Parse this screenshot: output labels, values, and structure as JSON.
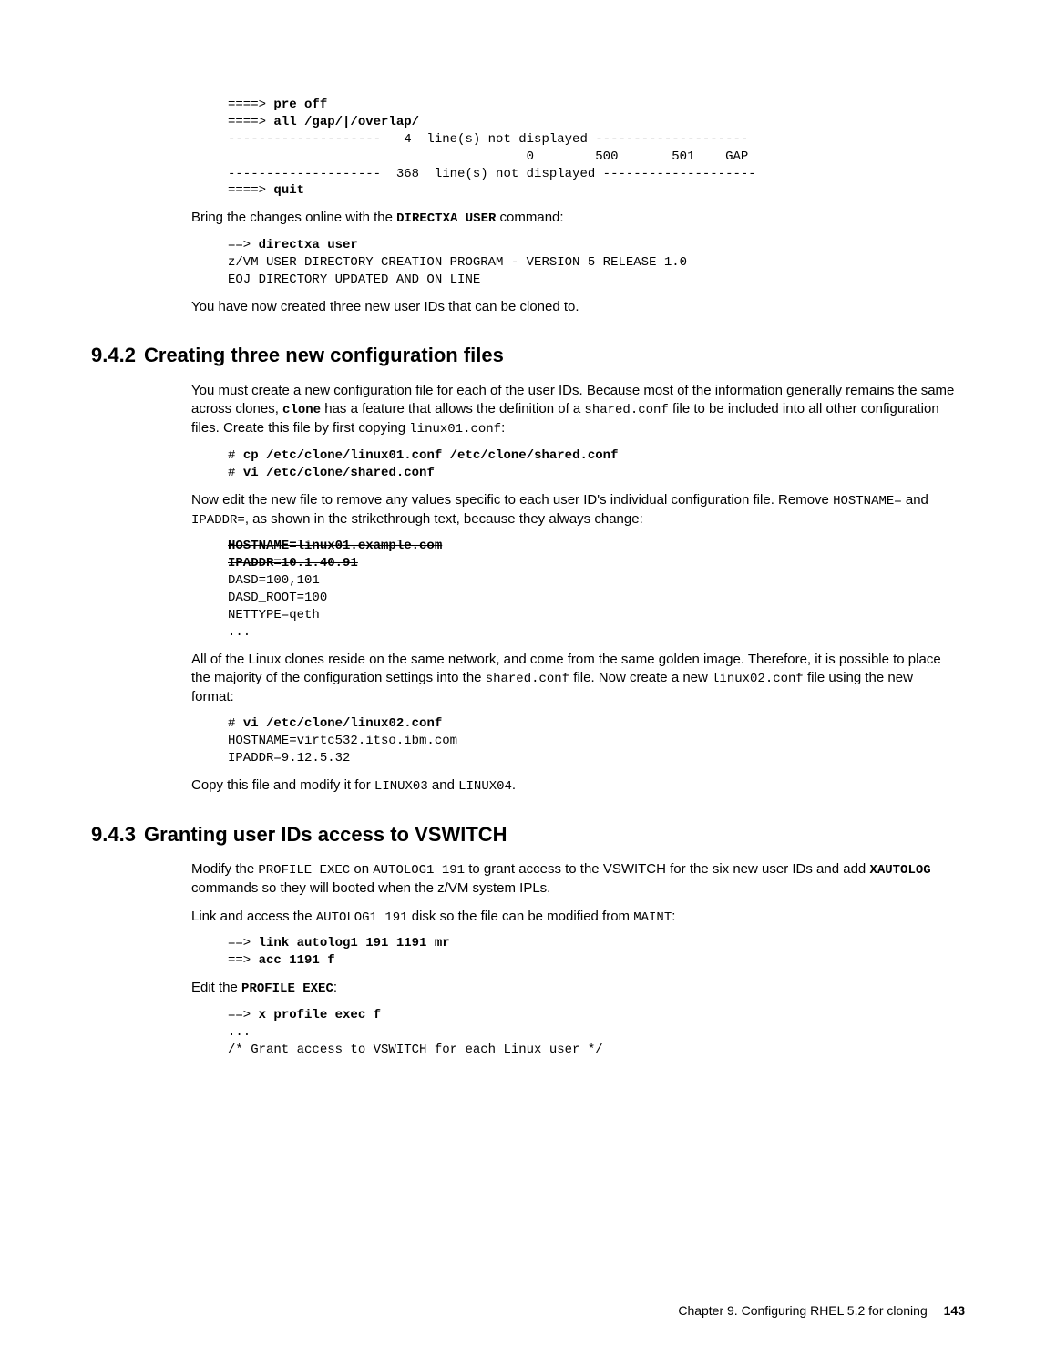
{
  "pre_top": {
    "l1a": "====> ",
    "l1b": "pre off",
    "l2a": "====> ",
    "l2b": "all /gap/|/overlap/",
    "l3": "--------------------   4  line(s) not displayed --------------------",
    "l4": "                                       0        500       501    GAP",
    "l5": "--------------------  368  line(s) not displayed --------------------",
    "l6a": "====> ",
    "l6b": "quit"
  },
  "para1_a": "Bring the changes online with the ",
  "para1_cmd": "DIRECTXA USER",
  "para1_b": " command:",
  "pre_directxa": {
    "l1a": "==> ",
    "l1b": "directxa user",
    "l2": "z/VM USER DIRECTORY CREATION PROGRAM - VERSION 5 RELEASE 1.0",
    "l3": "EOJ DIRECTORY UPDATED AND ON LINE"
  },
  "para2": "You have now created three new user IDs that can be cloned to.",
  "sec_942_num": "9.4.2",
  "sec_942_title": "Creating three new configuration files",
  "p942_1a": "You must create a new configuration file for each of the user IDs. Because most of the information generally remains the same across clones, ",
  "p942_1_cmd": "clone",
  "p942_1b": " has a feature that allows the definition of a ",
  "p942_1_file1": "shared.conf",
  "p942_1c": " file to be included into all other configuration files. Create this file by first copying ",
  "p942_1_file2": "linux01.conf",
  "p942_1d": ":",
  "pre_cp": {
    "l1a": "# ",
    "l1b": "cp /etc/clone/linux01.conf /etc/clone/shared.conf",
    "l2a": "# ",
    "l2b": "vi /etc/clone/shared.conf"
  },
  "p942_2a": "Now edit the new file to remove any values specific to each user ID's individual configuration file. Remove ",
  "p942_2_m1": "HOSTNAME=",
  "p942_2b": " and ",
  "p942_2_m2": "IPADDR=",
  "p942_2c": ", as shown in the strikethrough text, because they always change:",
  "pre_shared": {
    "l1": "HOSTNAME=linux01.example.com",
    "l2": "IPADDR=10.1.40.91",
    "l3": "DASD=100,101",
    "l4": "DASD_ROOT=100",
    "l5": "NETTYPE=qeth",
    "l6": "..."
  },
  "p942_3a": "All of the Linux clones reside on the same network, and come from the same golden image. Therefore, it is possible to place the majority of the configuration settings into the ",
  "p942_3_m1": "shared.conf",
  "p942_3b": " file. Now create a new ",
  "p942_3_m2": "linux02.conf",
  "p942_3c": " file using the new format:",
  "pre_linux02": {
    "l1a": "# ",
    "l1b": "vi /etc/clone/linux02.conf",
    "l2": "HOSTNAME=virtc532.itso.ibm.com",
    "l3": "IPADDR=9.12.5.32"
  },
  "p942_4a": "Copy this file and modify it for ",
  "p942_4_m1": "LINUX03",
  "p942_4b": " and ",
  "p942_4_m2": "LINUX04",
  "p942_4c": ".",
  "sec_943_num": "9.4.3",
  "sec_943_title": "Granting user IDs access to VSWITCH",
  "p943_1a": "Modify the ",
  "p943_1_m1": "PROFILE EXEC",
  "p943_1b": " on ",
  "p943_1_m2": "AUTOLOG1 191",
  "p943_1c": " to grant access to the VSWITCH for the six new user IDs and add ",
  "p943_1_mb": "XAUTOLOG",
  "p943_1d": " commands so they will booted when the z/VM system IPLs.",
  "p943_2a": "Link and access the ",
  "p943_2_m1": "AUTOLOG1 191",
  "p943_2b": " disk so the file can be modified from ",
  "p943_2_m2": "MAINT",
  "p943_2c": ":",
  "pre_link": {
    "l1a": "==> ",
    "l1b": "link autolog1 191 1191 mr",
    "l2a": "==> ",
    "l2b": "acc 1191 f"
  },
  "p943_3a": "Edit the ",
  "p943_3_mb": "PROFILE EXEC",
  "p943_3b": ":",
  "pre_profile": {
    "l1a": "==> ",
    "l1b": "x profile exec f",
    "l2": "...",
    "l3": "/* Grant access to VSWITCH for each Linux user */"
  },
  "footer_chapter": "Chapter 9. Configuring RHEL 5.2 for cloning",
  "footer_page": "143"
}
